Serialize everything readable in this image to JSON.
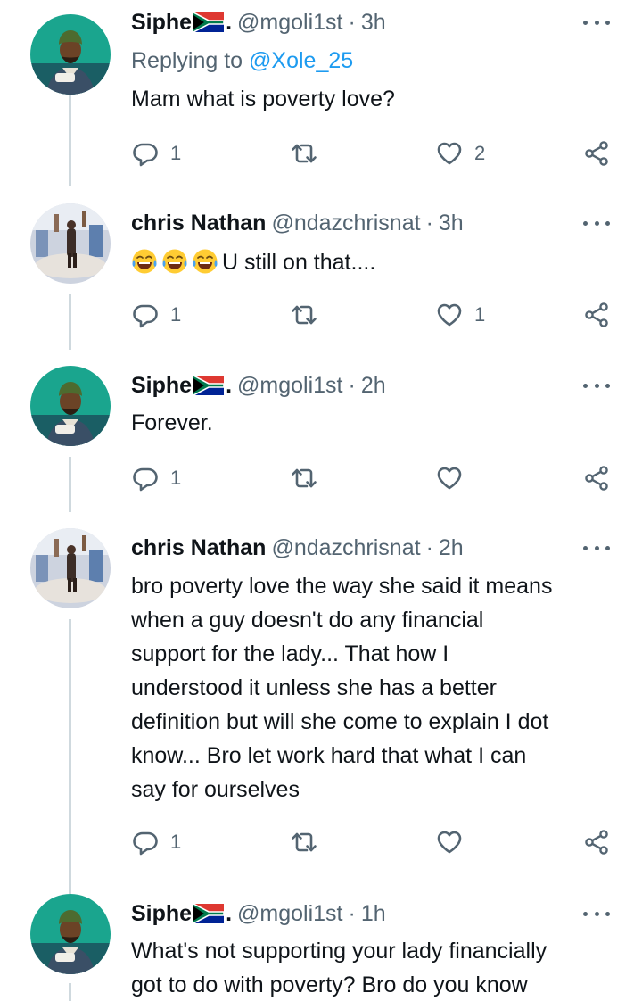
{
  "tweets": [
    {
      "name": "Siphe",
      "name_suffix": ".",
      "handle": "@mgoli1st",
      "separator": "·",
      "time": "3h",
      "replying_label": "Replying to",
      "replying_to": "@Xole_25",
      "text": "Mam what is poverty love?",
      "reply_count": "1",
      "retweet_count": "",
      "like_count": "2",
      "avatar": "siphe-avatar"
    },
    {
      "name": "chris Nathan",
      "handle": "@ndazchrisnat",
      "separator": "·",
      "time": "3h",
      "emojis": [
        "face-with-tears-of-joy",
        "face-with-tears-of-joy",
        "face-with-tears-of-joy"
      ],
      "text": "U still on that....",
      "reply_count": "1",
      "retweet_count": "",
      "like_count": "1",
      "avatar": "chris-avatar"
    },
    {
      "name": "Siphe",
      "name_suffix": ".",
      "handle": "@mgoli1st",
      "separator": "·",
      "time": "2h",
      "text": "Forever.",
      "reply_count": "1",
      "retweet_count": "",
      "like_count": "",
      "avatar": "siphe-avatar"
    },
    {
      "name": "chris Nathan",
      "handle": "@ndazchrisnat",
      "separator": "·",
      "time": "2h",
      "text_lines": [
        "bro poverty love the way she said it means",
        "when a guy doesn't do any financial",
        "support for the lady... That how I",
        "understood it unless she has a better",
        "definition but will she come to explain I dot",
        "know... Bro let work hard that what I can",
        "say for ourselves"
      ],
      "reply_count": "1",
      "retweet_count": "",
      "like_count": "",
      "avatar": "chris-avatar"
    },
    {
      "name": "Siphe",
      "name_suffix": ".",
      "handle": "@mgoli1st",
      "separator": "·",
      "time": "1h",
      "text_lines": [
        "What's not supporting your lady financially",
        "got to do with poverty? Bro do you know"
      ],
      "avatar": "siphe-avatar"
    }
  ],
  "icons": {
    "reply": "reply-icon",
    "retweet": "retweet-icon",
    "like": "heart-icon",
    "share": "share-icon",
    "more": "more-icon",
    "flag": "south-africa-flag-icon"
  },
  "colors": {
    "text_primary": "#0f1419",
    "text_secondary": "#536471",
    "link": "#1d9bf0",
    "thread_line": "#cfd9de"
  }
}
